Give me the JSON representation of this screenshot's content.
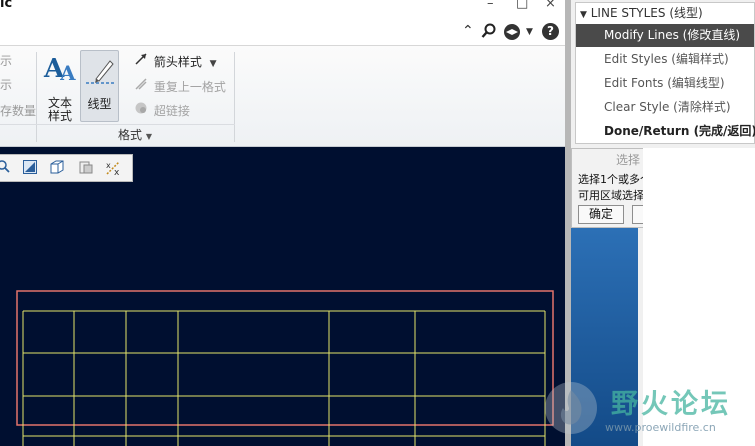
{
  "titlebar": {
    "title_fragment": "ic",
    "restore_label": "□",
    "close_label": "×"
  },
  "ribbon": {
    "left_group_items": [
      "示",
      "示",
      "存数量"
    ],
    "text_style_label": "文本\n样式",
    "text_style_line1": "文本",
    "text_style_line2": "样式",
    "line_style_label": "线型",
    "arrow_style_label": "箭头样式",
    "repeat_format_label": "重复上一格式",
    "hyperlink_label": "超链接",
    "group_title": "格式"
  },
  "menu_manager": {
    "header": "LINE STYLES (线型)",
    "items": [
      {
        "label": "Modify Lines (修改直线)",
        "selected": true
      },
      {
        "label": "Edit Styles (编辑样式)"
      },
      {
        "label": "Edit Fonts (编辑线型)"
      },
      {
        "label": "Clear Style (清除样式)"
      },
      {
        "label": "Done/Return (完成/返回)",
        "bold": true
      }
    ]
  },
  "select_dialog": {
    "title": "选择",
    "line1": "选择1个或多个项。",
    "line2": "可用区域选择。",
    "ok_label": "确定",
    "cancel_label": "取消"
  },
  "watermark": {
    "title": "野火论坛",
    "url": "www.proewildfire.cn"
  },
  "colors": {
    "canvas_bg": "#000f30",
    "table_lines": "#e4e46a",
    "selection_box": "#e2736a",
    "menu_selected": "#4a4a4a"
  }
}
